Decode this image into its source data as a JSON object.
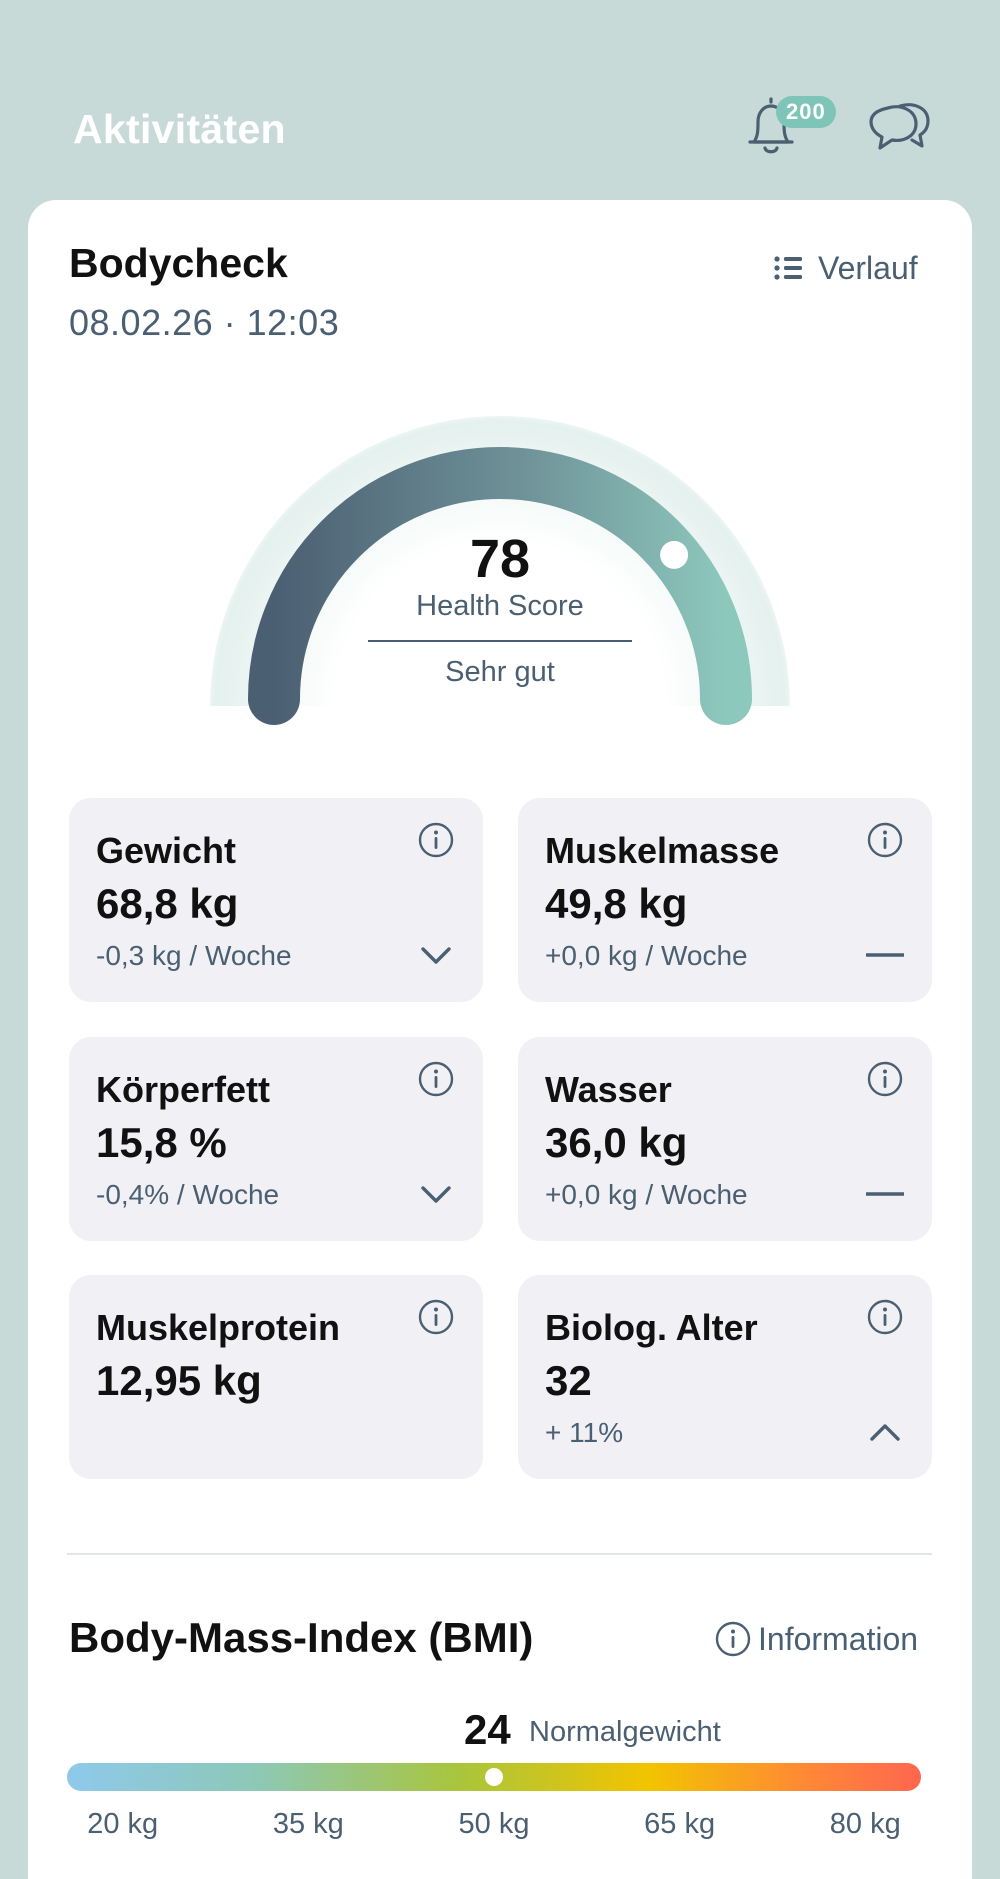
{
  "header": {
    "title": "Aktivitäten",
    "notification_count": "200",
    "icons": [
      "bell-icon",
      "chat-icon"
    ]
  },
  "bodycheck": {
    "title": "Bodycheck",
    "datetime": "08.02.26 · 12:03",
    "history_label": "Verlauf",
    "gauge": {
      "score": "78",
      "score_fraction": 0.78,
      "label": "Health Score",
      "status": "Sehr gut"
    }
  },
  "metrics": [
    {
      "label": "Gewicht",
      "value": "68,8 kg",
      "trend": "-0,3 kg / Woche",
      "direction": "down"
    },
    {
      "label": "Muskelmasse",
      "value": "49,8 kg",
      "trend": "+0,0 kg / Woche",
      "direction": "flat"
    },
    {
      "label": "Körperfett",
      "value": "15,8 %",
      "trend": "-0,4% / Woche",
      "direction": "down"
    },
    {
      "label": "Wasser",
      "value": "36,0 kg",
      "trend": "+0,0 kg / Woche",
      "direction": "flat"
    },
    {
      "label": "Muskelprotein",
      "value": "12,95 kg",
      "trend": "",
      "direction": "none"
    },
    {
      "label": "Biolog. Alter",
      "value": "32",
      "trend": "+ 11%",
      "direction": "up"
    }
  ],
  "bmi": {
    "title": "Body-Mass-Index (BMI)",
    "info_label": "Information",
    "value": "24",
    "status": "Normalgewicht",
    "marker_weight_kg": 50,
    "scale_min_kg": 15.5,
    "scale_max_kg": 84.5,
    "ticks": [
      "20 kg",
      "35 kg",
      "50 kg",
      "65 kg",
      "80 kg"
    ],
    "tick_values_kg": [
      20,
      35,
      50,
      65,
      80
    ]
  },
  "colors": {
    "background": "#c8dad8",
    "card": "#ffffff",
    "tile": "#f1f1f5",
    "text_primary": "#111111",
    "text_secondary": "#4b5f72",
    "badge": "#7fc4b8",
    "gauge_start": "#4b5f72",
    "gauge_end": "#8dc8bd"
  }
}
